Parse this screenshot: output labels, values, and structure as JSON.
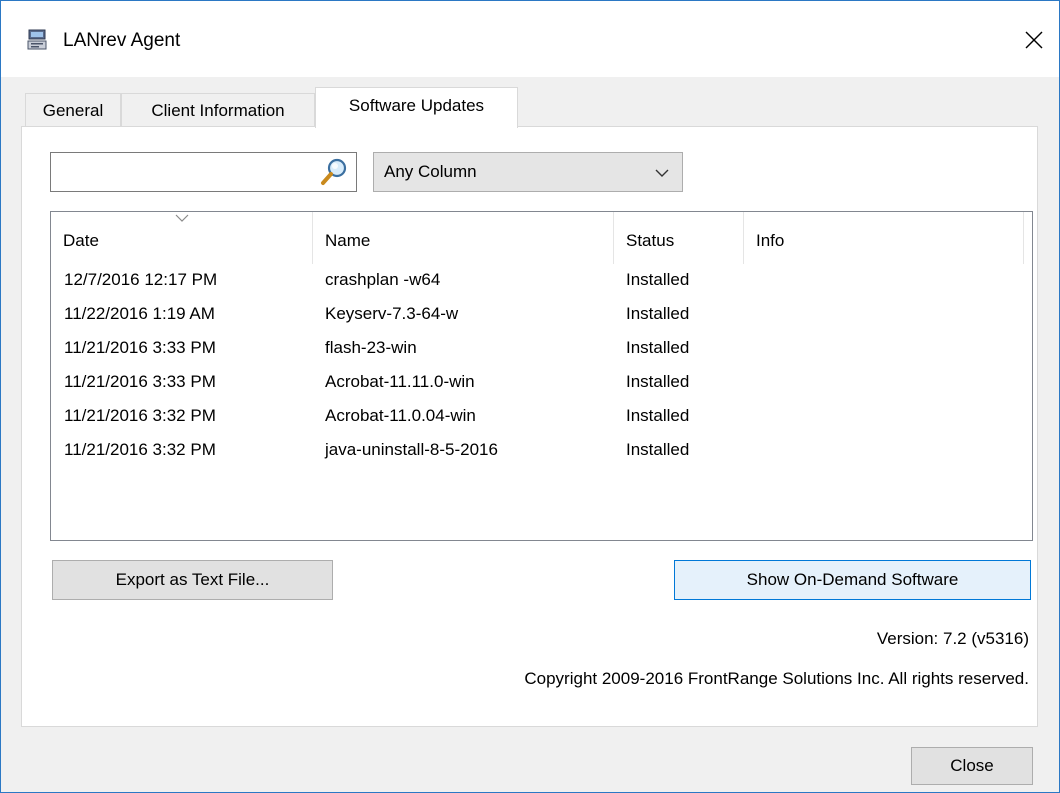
{
  "window": {
    "title": "LANrev Agent",
    "close_glyph": "✕"
  },
  "tabs": [
    {
      "label": "General"
    },
    {
      "label": "Client Information"
    },
    {
      "label": "Software Updates"
    }
  ],
  "active_tab": "Software Updates",
  "search": {
    "value": "",
    "placeholder": "",
    "icon": "search-icon"
  },
  "column_filter": {
    "selected": "Any Column"
  },
  "table": {
    "columns": [
      "Date",
      "Name",
      "Status",
      "Info"
    ],
    "sorted_column": "Date",
    "rows": [
      {
        "date": "12/7/2016 12:17 PM",
        "name": "crashplan -w64",
        "status": "Installed",
        "info": ""
      },
      {
        "date": "11/22/2016 1:19 AM",
        "name": "Keyserv-7.3-64-w",
        "status": "Installed",
        "info": ""
      },
      {
        "date": "11/21/2016 3:33 PM",
        "name": "flash-23-win",
        "status": "Installed",
        "info": ""
      },
      {
        "date": "11/21/2016 3:33 PM",
        "name": "Acrobat-11.11.0-win",
        "status": "Installed",
        "info": ""
      },
      {
        "date": "11/21/2016 3:32 PM",
        "name": "Acrobat-11.0.04-win",
        "status": "Installed",
        "info": ""
      },
      {
        "date": "11/21/2016 3:32 PM",
        "name": "java-uninstall-8-5-2016",
        "status": "Installed",
        "info": ""
      }
    ]
  },
  "buttons": {
    "export": "Export as Text File...",
    "on_demand": "Show On-Demand Software",
    "close": "Close"
  },
  "footer": {
    "version": "Version: 7.2 (v5316)",
    "copyright": "Copyright 2009-2016 FrontRange Solutions Inc. All rights reserved."
  },
  "colors": {
    "window_border": "#2b78c4",
    "focus_button_border": "#0078d7",
    "focus_button_bg": "#e5f1fb"
  }
}
